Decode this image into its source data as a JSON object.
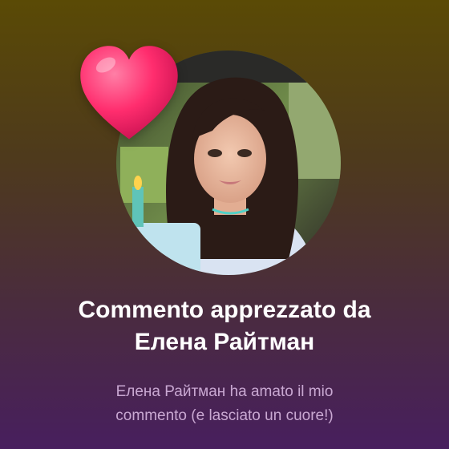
{
  "notification": {
    "title_line1": "Commento apprezzato da",
    "title_line2": "Елена Райтман",
    "message_line1": "Елена Райтман ha amato il mio",
    "message_line2": "commento (e lasciato un cuore!)"
  },
  "icons": {
    "reaction": "heart-icon"
  },
  "colors": {
    "heart": "#ff2d6e",
    "title": "#ffffff",
    "message": "#c9a8d2",
    "background_top": "#5a4a05",
    "background_bottom": "#481f5e"
  }
}
